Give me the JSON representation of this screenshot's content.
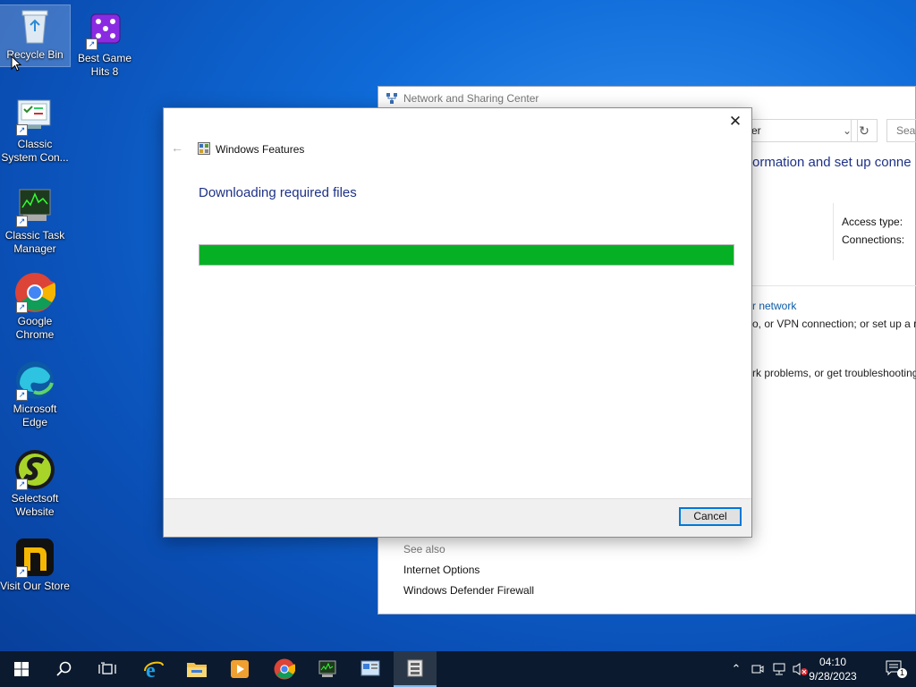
{
  "desktop": {
    "icons": [
      {
        "label": "Recycle Bin"
      },
      {
        "label": "Best Game Hits 8"
      },
      {
        "label": "Classic System Con..."
      },
      {
        "label": "Classic Task Manager"
      },
      {
        "label": "Google Chrome"
      },
      {
        "label": "Microsoft Edge"
      },
      {
        "label": "Selectsoft Website"
      },
      {
        "label": "Visit Our Store"
      }
    ]
  },
  "background_window": {
    "title": "Network and Sharing Center",
    "address_partial": "er",
    "search_placeholder": "Sear",
    "heading_partial": "ormation and set up conne",
    "access_type_label": "Access type:",
    "connections_label": "Connections:",
    "link_partial": "r network",
    "text_line1": "o, or VPN connection; or set up a ro",
    "text_line2": "rk problems, or get troubleshooting",
    "see_also": "See also",
    "see_also_links": [
      "Internet Options",
      "Windows Defender Firewall"
    ]
  },
  "dialog": {
    "title": "Windows Features",
    "heading": "Downloading required files",
    "progress_fraction": 1.0,
    "progress_color": "#06b025",
    "cancel_label": "Cancel"
  },
  "taskbar": {
    "clock_time": "04:10",
    "clock_date": "9/28/2023",
    "notification_count": "1",
    "icons": [
      "windows-start-icon",
      "search-icon",
      "task-view-icon",
      "internet-explorer-icon",
      "file-explorer-icon",
      "media-player-icon",
      "chrome-icon",
      "task-manager-icon",
      "control-panel-icon",
      "windows-features-icon"
    ]
  }
}
